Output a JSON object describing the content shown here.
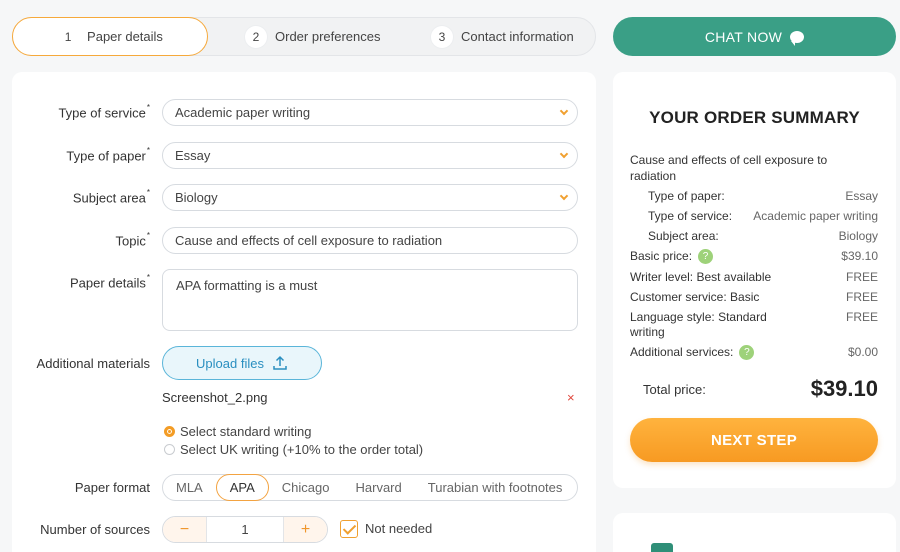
{
  "steps": [
    {
      "num": "1",
      "label": "Paper details"
    },
    {
      "num": "2",
      "label": "Order preferences"
    },
    {
      "num": "3",
      "label": "Contact information"
    }
  ],
  "chat": {
    "label": "CHAT NOW"
  },
  "form": {
    "service": {
      "label": "Type of service",
      "value": "Academic paper writing"
    },
    "paper_type": {
      "label": "Type of paper",
      "value": "Essay"
    },
    "subject": {
      "label": "Subject area",
      "value": "Biology"
    },
    "topic": {
      "label": "Topic",
      "value": "Cause and effects of cell exposure to radiation"
    },
    "details": {
      "label": "Paper details",
      "value": "APA formatting is a must"
    },
    "materials": {
      "label": "Additional materials",
      "upload_label": "Upload files",
      "file_name": "Screenshot_2.png",
      "remove_symbol": "×"
    },
    "writing_options": [
      "Select standard writing",
      "Select UK writing (+10% to the order total)"
    ],
    "format": {
      "label": "Paper format",
      "options": [
        "MLA",
        "APA",
        "Chicago",
        "Harvard",
        "Turabian with footnotes"
      ],
      "selected": "APA"
    },
    "sources": {
      "label": "Number of sources",
      "minus": "−",
      "value": "1",
      "plus": "+",
      "not_needed_label": "Not needed"
    }
  },
  "summary": {
    "title": "YOUR ORDER SUMMARY",
    "topic": "Cause and effects of cell exposure to radiation",
    "rows": [
      {
        "label": "Type of paper:",
        "value": "Essay"
      },
      {
        "label": "Type of service:",
        "value": "Academic paper writing"
      },
      {
        "label": "Subject area:",
        "value": "Biology"
      }
    ],
    "basic_price": {
      "label": "Basic price:",
      "help": "?",
      "value": "$39.10"
    },
    "writer_level": {
      "label": "Writer level: Best available",
      "value": "FREE"
    },
    "customer_service": {
      "label": "Customer service: Basic",
      "value": "FREE"
    },
    "language_style": {
      "label": "Language style: Standard writing",
      "value": "FREE"
    },
    "additional_services": {
      "label": "Additional services:",
      "help": "?",
      "value": "$0.00"
    },
    "total_label": "Total price:",
    "total_value": "$39.10",
    "next_label": "NEXT STEP"
  },
  "colors": {
    "accent": "#f39c25",
    "chat": "#3a9f86",
    "link": "#2a8fc0"
  }
}
